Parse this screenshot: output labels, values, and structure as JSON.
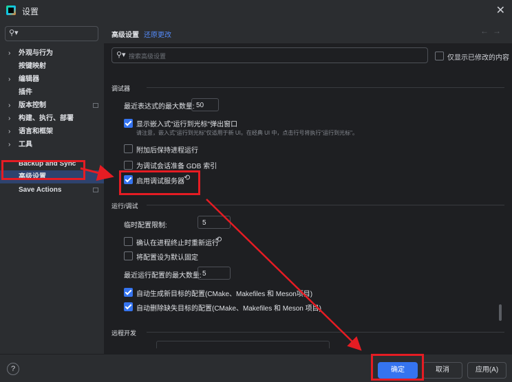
{
  "window": {
    "title": "设置"
  },
  "sidebar": {
    "items": [
      {
        "label": "外观与行为",
        "chevron": true,
        "proj": false
      },
      {
        "label": "按键映射",
        "chevron": false,
        "proj": false
      },
      {
        "label": "编辑器",
        "chevron": true,
        "proj": false
      },
      {
        "label": "插件",
        "chevron": false,
        "proj": false
      },
      {
        "label": "版本控制",
        "chevron": true,
        "proj": true
      },
      {
        "label": "构建、执行、部署",
        "chevron": true,
        "proj": false
      },
      {
        "label": "语言和框架",
        "chevron": true,
        "proj": false
      },
      {
        "label": "工具",
        "chevron": true,
        "proj": false
      },
      {
        "label": "Backup and Sync",
        "chevron": false,
        "proj": false
      },
      {
        "label": "高级设置",
        "chevron": false,
        "proj": false,
        "selected": true
      },
      {
        "label": "Save Actions",
        "chevron": false,
        "proj": true
      }
    ]
  },
  "header": {
    "crumb": "高级设置",
    "reset_link": "还原更改"
  },
  "search": {
    "placeholder": "搜索高级设置",
    "modified_only_label": "仅显示已修改的内容"
  },
  "debugger": {
    "section": "调试器",
    "recent_expr_label": "最近表达式的最大数量:",
    "recent_expr_value": "50",
    "show_inline_run_to_cursor": "显示嵌入式\"运行到光标\"弹出窗口",
    "show_inline_hint": "请注意，嵌入式\"运行到光标\"仅适用于新 UI。在经典 UI 中，点击行号将执行\"运行到光标\"。",
    "keep_process_on_attach": "附加后保持进程运行",
    "gdb_index": "为调试会话准备 GDB 索引",
    "enable_debug_server": "启用调试服务器"
  },
  "run_debug": {
    "section": "运行/调试",
    "temp_limit_label": "临时配置限制:",
    "temp_limit_value": "5",
    "confirm_rerun": "确认在进程终止时重新运行",
    "pin_default": "将配置设为默认固定",
    "recent_configs_label": "最近运行配置的最大数量:",
    "recent_configs_value": "5",
    "auto_generate": "自动生成新目标的配置(CMake、Makefiles 和 Meson项目)",
    "auto_delete": "自动删除缺失目标的配置(CMake、Makefiles 和 Meson 项目)"
  },
  "remote": {
    "section": "远程开发"
  },
  "footer": {
    "help": "?",
    "ok": "确定",
    "cancel": "取消",
    "apply": "应用(A)"
  },
  "icons": {
    "app": "app-logo-icon",
    "close": "close-icon",
    "search": "search-icon",
    "reset": "reset-arrow-icon",
    "help": "help-icon"
  },
  "colors": {
    "accent": "#3574f0",
    "annotation": "#e51c23",
    "selection": "#2e436e"
  }
}
